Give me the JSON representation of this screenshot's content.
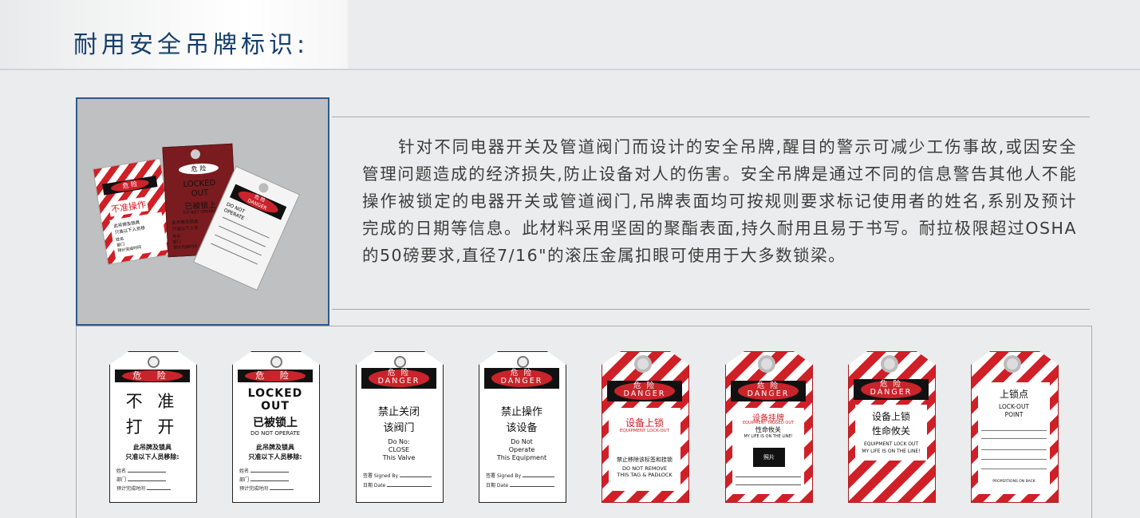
{
  "header": {
    "title": "耐用安全吊牌标识:"
  },
  "description": "针对不同电器开关及管道阀门而设计的安全吊牌,醒目的警示可减少工伤事故,或因安全管理问题造成的经济损失,防止设备对人的伤害。安全吊牌是通过不同的信息警告其他人不能操作被锁定的电器开关或管道阀门,吊牌表面均可按规则要求标记使用者的姓名,系别及预计完成的日期等信息。此材料采用坚固的聚酯表面,持久耐用且易于书写。耐拉极限超过OSHA的50磅要求,直径7/16\"的滚压金属扣眼可使用于大多数锁梁。",
  "photo": {
    "tag1": {
      "header": "危 险",
      "main": "不准操作",
      "body": [
        "此吊牌及锁具",
        "只准以下人员移",
        "姓名",
        "部门",
        "预计完成时间"
      ]
    },
    "tag2": {
      "header": "危 险",
      "main": [
        "LOCKED",
        "OUT",
        "已被锁上"
      ],
      "sub": "DO NOT OPERATE",
      "body": [
        "此吊牌及锁具",
        "只准以下人员",
        "姓名",
        "部门",
        "预计完成时间"
      ]
    },
    "tag3": {
      "header": "危 险",
      "en": "DANGER",
      "main": [
        "DO NOT",
        "OPERATE"
      ]
    }
  },
  "tags": [
    {
      "header": "危 险",
      "lines": [
        "不 准",
        "打 开"
      ],
      "body": [
        "此吊牌及锁具",
        "只准以下人员移除:"
      ],
      "fields": [
        "姓名",
        "部门",
        "预计完成时间"
      ]
    },
    {
      "header": "危 险",
      "lines": [
        "LOCKED",
        "OUT",
        "已被锁上"
      ],
      "sub": "DO NOT OPERATE",
      "body": [
        "此吊牌及锁具",
        "只准以下人员移除:"
      ],
      "fields": [
        "姓名",
        "部门",
        "预计完成时间"
      ]
    },
    {
      "header": "危 险",
      "en": "DANGER",
      "lines": [
        "禁止关闭",
        "该阀门"
      ],
      "body": [
        "Do No:",
        "CLOSE",
        "This Valve"
      ],
      "fields": [
        "签署 Signed By",
        "日期 Date"
      ]
    },
    {
      "header": "危 险",
      "en": "DANGER",
      "lines": [
        "禁止操作",
        "该设备"
      ],
      "body": [
        "Do Not",
        "Operate",
        "This Equipment"
      ],
      "fields": [
        "签署 Signed By",
        "日期 Date"
      ]
    },
    {
      "header": "危 险",
      "en": "DANGER",
      "lines": [
        "设备上锁"
      ],
      "sub": "EQUIPMENT LOCK-OUT",
      "body": [
        "禁止移除该标签和挂锁",
        "DO NOT REMOVE",
        "THIS TAG & PADLOCK"
      ]
    },
    {
      "header": "危 险",
      "en": "DANGER",
      "lines": [
        "设备挂牌"
      ],
      "sub": "EQUIPMENT TAGGED OUT",
      "body": [
        "性命攸关",
        "MY LIFE IS ON THE LINE!"
      ],
      "photo": "照片"
    },
    {
      "header": "危 险",
      "en": "DANGER",
      "lines": [
        "设备上锁",
        "性命攸关"
      ],
      "body": [
        "EQUIPMENT LOCK OUT",
        "MY LIFE IS ON THE LINE!"
      ]
    },
    {
      "lines": [
        "上锁点",
        "LOCK-OUT",
        "POINT"
      ],
      "sub": "PROPERTIONS ON BACK"
    }
  ]
}
